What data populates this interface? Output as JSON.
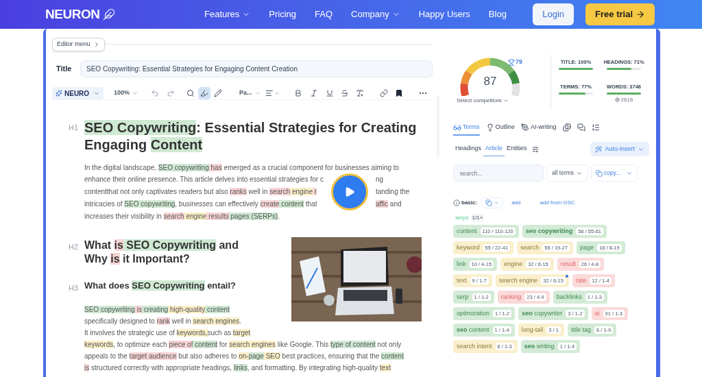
{
  "nav": {
    "logo": "NEURON",
    "links": [
      {
        "label": "Features",
        "dropdown": true
      },
      {
        "label": "Pricing",
        "dropdown": false
      },
      {
        "label": "FAQ",
        "dropdown": false
      },
      {
        "label": "Company",
        "dropdown": true
      },
      {
        "label": "Happy Users",
        "dropdown": false
      },
      {
        "label": "Blog",
        "dropdown": false
      }
    ],
    "login": "Login",
    "cta": "Free trial"
  },
  "editor": {
    "menu_button": "Editor menu",
    "title_label": "Title",
    "title_value": "SEO Copywriting: Essential Strategies for Engaging Content Creation",
    "toolbar": {
      "brand": "NEURO",
      "zoom": "100%",
      "paragraph_style": "Pa...",
      "tools": [
        {
          "kind": "search",
          "selected": false
        },
        {
          "kind": "highlighter",
          "selected": true
        },
        {
          "kind": "pen",
          "selected": false
        }
      ]
    }
  },
  "document": {
    "blocks": [
      {
        "kind": "heading",
        "level": "H1",
        "lines": [
          [
            {
              "t": "SEO Copywriting",
              "color": "#cfe9d3"
            },
            {
              "t": ": Essential Strategies for Creating"
            }
          ],
          [
            {
              "t": "Engaging "
            },
            {
              "t": "Content",
              "color": "#cfe9d3"
            }
          ]
        ]
      },
      {
        "kind": "video_paragraph",
        "top": [
          {
            "t": "In the digital landscape, "
          },
          {
            "t": "SEO copywriting",
            "color": "#cfe9d3"
          },
          {
            "t": " has",
            "color": "#f8d5d5"
          },
          {
            "t": " emerged as a crucial component for businesses aiming to"
          }
        ],
        "wrapped": [
          {
            "left": [
              {
                "t": "enhance their online presence. This article delves into essential strategies for c"
              }
            ],
            "right": [
              {
                "t": "ng"
              }
            ]
          },
          {
            "left": [
              {
                "t": "contentthat not only captivates readers but also "
              },
              {
                "t": "ranks",
                "color": "#f8d5d5"
              },
              {
                "t": " well in "
              },
              {
                "t": "search",
                "color": "#f8d5d5"
              },
              {
                "t": " engine",
                "color": "#fbefc8"
              },
              {
                "t": " r",
                "color": "#f8d5d5"
              }
            ],
            "right": [
              {
                "t": "tanding the"
              }
            ]
          },
          {
            "left": [
              {
                "t": "intricacies of "
              },
              {
                "t": "SEO copywriting",
                "color": "#cfe9d3"
              },
              {
                "t": ", businesses can effectively "
              },
              {
                "t": "create",
                "color": "#f8d5d5"
              },
              {
                "t": " content",
                "color": "#cfe9d3"
              },
              {
                "t": " that "
              }
            ],
            "right": [
              {
                "t": "affic",
                "color": "#f8d5d5"
              },
              {
                "t": " and"
              }
            ]
          }
        ],
        "bottom": [
          {
            "t": "increases their visibility in "
          },
          {
            "t": "search",
            "color": "#f8d5d5"
          },
          {
            "t": " engine",
            "color": "#fbefc8"
          },
          {
            "t": " results",
            "color": "#f8d5d5"
          },
          {
            "t": " pages",
            "color": "#cfe9d3"
          },
          {
            "t": " (SERPs)",
            "color": "#cfe9d3"
          },
          {
            "t": "."
          }
        ]
      },
      {
        "kind": "picture"
      },
      {
        "kind": "heading",
        "level": "H2",
        "lines": [
          [
            {
              "t": "What "
            },
            {
              "t": "is",
              "color": "#f8d5d5"
            },
            {
              "t": " SEO Copywriting",
              "color": "#cfe9d3"
            },
            {
              "t": " and"
            }
          ],
          [
            {
              "t": "Why "
            },
            {
              "t": "is",
              "color": "#f8d5d5"
            },
            {
              "t": " it Important?"
            }
          ]
        ]
      },
      {
        "kind": "heading",
        "level": "H3",
        "lines": [
          [
            {
              "t": "What does "
            },
            {
              "t": "SEO Copywriting",
              "color": "#cfe9d3"
            },
            {
              "t": " entail?"
            }
          ]
        ]
      },
      {
        "kind": "paragraph",
        "lines": [
          [
            {
              "t": "SEO copywriting",
              "color": "#cfe9d3"
            },
            {
              "t": " is",
              "color": "#f8d5d5"
            },
            {
              "t": " creating",
              "color": "#cfe9d3"
            },
            {
              "t": " high-quality",
              "color": "#fbefc8"
            },
            {
              "t": " content",
              "color": "#cfe9d3"
            }
          ],
          [
            {
              "t": "specifically designed to "
            },
            {
              "t": "rank",
              "color": "#f8d5d5"
            },
            {
              "t": " well in "
            },
            {
              "t": "search engines",
              "color": "#fbefc8"
            },
            {
              "t": "."
            }
          ],
          [
            {
              "t": "It involves the strategic use of "
            },
            {
              "t": "keywords,",
              "color": "#fbefc8"
            },
            {
              "t": "such as "
            },
            {
              "t": "target",
              "color": "#fbefc8"
            }
          ],
          [
            {
              "t": "keywords",
              "color": "#fbefc8"
            },
            {
              "t": ", to optimize each "
            },
            {
              "t": "piece of",
              "color": "#f8d5d5"
            },
            {
              "t": " content",
              "color": "#cfe9d3"
            },
            {
              "t": " for "
            },
            {
              "t": "search engines",
              "color": "#fbefc8"
            },
            {
              "t": " like Google. This "
            },
            {
              "t": "type of content",
              "color": "#cfe9d3"
            },
            {
              "t": " not only"
            }
          ],
          [
            {
              "t": "appeals to the "
            },
            {
              "t": "target audience",
              "color": "#f8d5d5"
            },
            {
              "t": " but also adheres to "
            },
            {
              "t": "on-",
              "color": "#fbefc8"
            },
            {
              "t": "page",
              "color": "#cfe9d3"
            },
            {
              "t": " SEO",
              "color": "#fbefc8"
            },
            {
              "t": " best practices, ensuring that the "
            },
            {
              "t": "content",
              "color": "#cfe9d3"
            }
          ],
          [
            {
              "t": "is",
              "color": "#f8d5d5"
            },
            {
              "t": " structured correctly with appropriate headings, "
            },
            {
              "t": "links",
              "color": "#cfe9d3"
            },
            {
              "t": ", and formatting. By integrating high-quality "
            },
            {
              "t": "text",
              "color": "#fbefc8"
            }
          ]
        ]
      }
    ]
  },
  "panel": {
    "score": {
      "value": "87",
      "level": 0.86,
      "competitor_score": "79",
      "select": "Select competitors"
    },
    "stats": [
      {
        "label": "TITLE: 100%",
        "level": 1
      },
      {
        "label": "HEADINGS: 71%",
        "level": 0.71
      },
      {
        "label": "TERMS: 77%",
        "level": 0.77
      },
      {
        "label": "WORDS: 3746",
        "level": 1,
        "note": "2616"
      }
    ],
    "tabs": [
      {
        "kind": "terms",
        "label": "Terms",
        "selected": true
      },
      {
        "kind": "outline",
        "label": "Outline",
        "selected": false
      },
      {
        "kind": "ai",
        "label": "AI-writing",
        "selected": false
      },
      {
        "kind": "images",
        "selected": false
      },
      {
        "kind": "chat",
        "selected": false
      },
      {
        "kind": "list",
        "selected": false
      }
    ],
    "subtabs": [
      {
        "label": "Headings",
        "selected": false
      },
      {
        "label": "Article",
        "selected": true
      },
      {
        "label": "Entities",
        "selected": false
      }
    ],
    "auto_insert": "Auto-insert",
    "search": {
      "placeholder": "search..."
    },
    "filter": "all terms",
    "copy": "copy...",
    "basic_label": "basic:",
    "add": "add",
    "add_gsc": "add from GSC",
    "serps": {
      "label": "serps",
      "count": "1/1+"
    },
    "terms": [
      {
        "name": "content",
        "count": "110 / 110-120",
        "color": "#d3ebd6"
      },
      {
        "name": "**seo copywriting**",
        "count": "56 / 55-61",
        "color": "#d3ebd6"
      },
      {
        "name": "keyword",
        "count": "55 / 22-41",
        "color": "#faefcd"
      },
      {
        "name": "search",
        "count": "55 / 19-27",
        "color": "#faefcd"
      },
      {
        "name": "page",
        "count": "18 / 8-19",
        "color": "#d3ebd6"
      },
      {
        "name": "link",
        "count": "10 / 4-15",
        "color": "#d3ebd6"
      },
      {
        "name": "engine",
        "count": "32 / 6-15",
        "color": "#faefcd"
      },
      {
        "name": "result",
        "count": "26 / 4-8",
        "color": "#fbdada"
      },
      {
        "name": "text",
        "count": "9 / 1-7",
        "color": "#faefcd"
      },
      {
        "name": "search engine",
        "count": "32 / 6-15",
        "color": "#faefcd",
        "flagged": true
      },
      {
        "name": "rate",
        "count": "12 / 1-4",
        "color": "#fbdada"
      },
      {
        "name": "serp",
        "count": "1 / 1-2",
        "color": "#d3ebd6"
      },
      {
        "name": "ranking",
        "count": "23 / 4-9",
        "color": "#fbdada"
      },
      {
        "name": "backlinks",
        "count": "1 / 1-3",
        "color": "#d3ebd6"
      },
      {
        "name": "optimization",
        "count": "1 / 1-2",
        "color": "#d3ebd6"
      },
      {
        "name": "**seo** copywriter",
        "count": "3 / 1-2",
        "color": "#d3ebd6"
      },
      {
        "name": "ai",
        "count": "91 / 1-3",
        "color": "#fbdada"
      },
      {
        "name": "**seo** content",
        "count": "1 / 1-4",
        "color": "#d3ebd6"
      },
      {
        "name": "long-tail",
        "count": "3 / 1",
        "color": "#faefcd"
      },
      {
        "name": "title tag",
        "count": "6 / 1-9",
        "color": "#d3ebd6"
      },
      {
        "name": "search intent",
        "count": "6 / 1-3",
        "color": "#faefcd"
      },
      {
        "name": "**seo** writing",
        "count": "1 / 1-4",
        "color": "#d3ebd6"
      }
    ]
  }
}
